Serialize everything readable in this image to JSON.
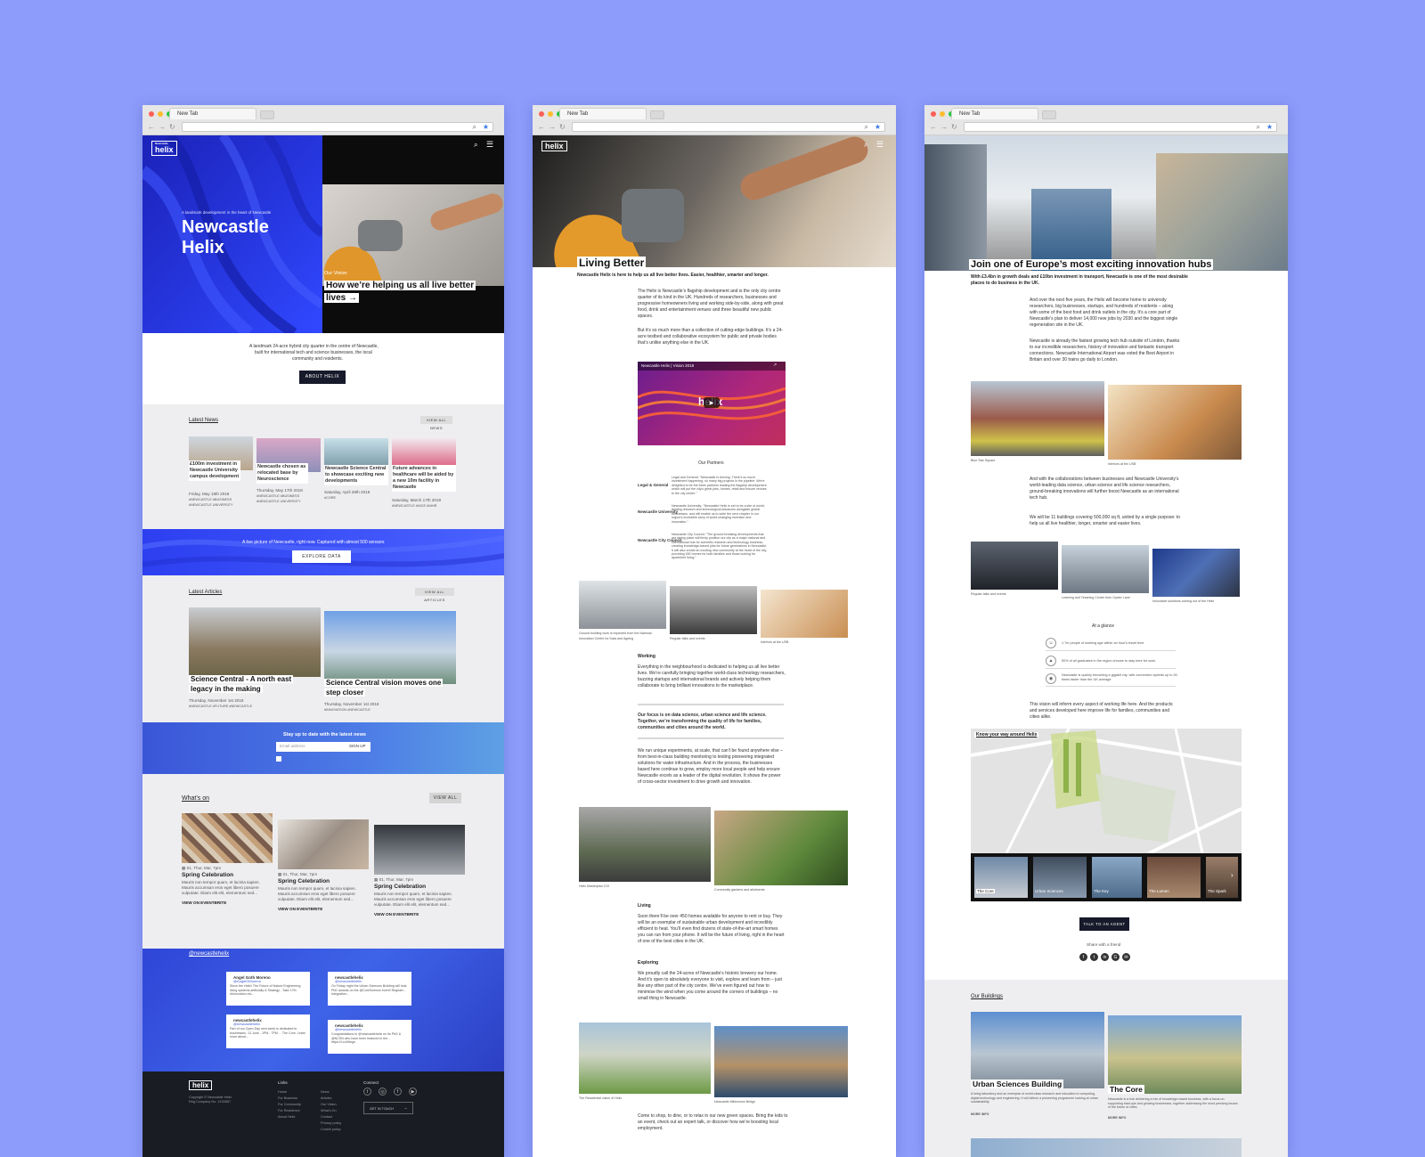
{
  "colors": {
    "bg": "#8d9cfb",
    "brand_blue": "#2a3be0",
    "dark": "#171a2a"
  },
  "browser": {
    "tab_title": "New Tab",
    "address": ""
  },
  "w1": {
    "logo": "helix",
    "logo_small": "Newcastle",
    "hero_kicker": "A landmark development in the heart of Newcastle",
    "hero_title_1": "Newcastle",
    "hero_title_2": "Helix",
    "vision_label": "Our Vision",
    "vision_title_1": "How we’re helping us all live better",
    "vision_title_2": "lives →",
    "intro_1": "A landmark 24-acre hybrid city quarter in the centre of Newcastle,",
    "intro_2": "built for international tech and science businesses, the local",
    "intro_3": "community and residents.",
    "about_btn": "ABOUT HELIX",
    "news_heading": "Latest News",
    "news_view_all": "VIEW ALL NEWS",
    "news": [
      {
        "title": "£100m investment in Newcastle University campus development",
        "date": "Friday, May 18th 2018",
        "tags": "#NEWCASTLE #BUSINESS #NEWCASTLE UNIVERSITY"
      },
      {
        "title": "Newcastle chosen as relocated base by Neuroscience",
        "date": "Thursday, May 17th 2018",
        "tags": "#NEWCASTLE #BUSINESS #NEWCASTLE UNIVERSITY"
      },
      {
        "title": "Newcastle Science Central to showcase exciting new developments",
        "date": "Saturday, April 28th 2018",
        "tags": "#CORE"
      },
      {
        "title": "Future advances in healthcare will be aided by a new 10m facility in Newcastle",
        "date": "Saturday, March 17th 2018",
        "tags": "#NEWCASTLE #NICE #NIHR"
      }
    ],
    "data_text": "A live picture of Newcastle, right now. Captured with almost 500 sensors",
    "data_btn": "EXPLORE DATA",
    "articles_heading": "Latest Articles",
    "articles_view_all": "VIEW ALL ARTICLES",
    "articles": [
      {
        "title_1": "Science Central - A north east",
        "title_2": "legacy in the making",
        "date": "Thursday, November 1st 2018",
        "tags": "#NEWCASTLE #FUTURE #NEWCASTLE"
      },
      {
        "title_1": "Science Central vision moves one",
        "title_2": "step closer",
        "date": "Thursday, November 1st 2018",
        "tags": "#INNOVATION #NEWCASTLE"
      }
    ],
    "newsletter_title": "Stay up to date with the latest news",
    "newsletter_placeholder": "Email address",
    "newsletter_btn": "SIGN UP",
    "whatson_heading": "What’s on",
    "whatson_view_all": "VIEW ALL",
    "events": [
      {
        "date": "01, Thur, Mar, 7pm",
        "title": "Spring Celebration",
        "desc": "Mauris non tempor quam, et lacinia sapien. Mauris accumsan eros eget libero posuere vulputate. Etiam elit elit, elementum sed...",
        "link": "VIEW ON EVENTBRITE"
      },
      {
        "date": "01, Thur, Mar, 7pm",
        "title": "Spring Celebration",
        "desc": "Mauris non tempor quam, et lacinia sapien. Mauris accumsan eros eget libero posuere vulputate. Etiam elit elit, elementum sed...",
        "link": "VIEW ON EVENTBRITE"
      },
      {
        "date": "01, Thur, Mar, 7pm",
        "title": "Spring Celebration",
        "desc": "Mauris non tempor quam, et lacinia sapien. Mauris accumsan eros eget libero posuere vulputate. Etiam elit elit, elementum sed...",
        "link": "VIEW ON EVENTBRITE"
      }
    ],
    "social_heading": "@newcastlehelix",
    "tweets": [
      {
        "user": "Angel Goth Moreno",
        "handle": "@AngelGMoreno",
        "text": "Since the Helix! The Future of Nature Engineering living systems artificially & Strategy - Take 17th #Innovation etc..."
      },
      {
        "user": "newcastlehelix",
        "handle": "@newcastlehelix",
        "text": "On Friday night the Urban Sciences Building will host PhD awards on the @CoreScience event! Register - Integration..."
      },
      {
        "user": "newcastlehelix",
        "handle": "@newcastlehelix",
        "text": "Part of our Open Day next week is dedicated to businesses. 13 June - 1PM - 7PM ... The Core. Learn more about..."
      },
      {
        "user": "newcastlehelix",
        "handle": "@newcastlehelix",
        "text": "Congratulations to @newcastlehelix on its PhD & @NCSN who have been featured in the... https://t.co/Mega"
      }
    ],
    "footer_logo": "helix",
    "footer_copy_1": "Copyright © Newcastle Helix",
    "footer_copy_2": "Reg Company No. 1234567",
    "footer_links_heading": "Links",
    "footer_links_1": [
      "Home",
      "For Business",
      "For Community",
      "For Residence",
      "About Helix"
    ],
    "footer_links_2": [
      "News",
      "Articles",
      "Our Vision",
      "What's On",
      "Contact",
      "Privacy policy",
      "Cookie policy"
    ],
    "footer_connect": "Connect",
    "footer_btn": "GET IN TOUCH"
  },
  "w2": {
    "logo": "helix",
    "title": "Living Better",
    "lead": "Newcastle Helix is here to help us all live better lives. Easier, healthier, smarter and longer.",
    "p1": "The Helix is Newcastle’s flagship development and is the only city centre quarter of its kind in the UK. Hundreds of researchers, businesses and progressive homeowners living and working side-by-side, along with great food, drink and entertainment venues and three beautiful new public spaces.",
    "p2": "But it’s so much more than a collection of cutting-edge buildings. It’s a 24-acre testbed and collaborative ecosystem for public and private bodies that’s unlike anything else in the UK.",
    "video_title": "Newcastle Helix | Vision 2018",
    "video_brand": "helix",
    "partners_heading": "Our Partners",
    "partners": [
      {
        "name": "Legal & General",
        "text": "Legal and General: \"Newcastle is thriving. There's so much investment happening, so many big projects in the pipeline. We're delighted to be the three partners leading the flagship development which will put the city's great jobs, homes, retail and leisure venues to the city centre.\""
      },
      {
        "name": "Newcastle University",
        "text": "Newcastle University: \"Newcastle Helix is set to be a site of world-leading research and technological advances alongside global businesses, and will enable us to write the next chapter in our region's incredible story of world-changing invention and innovation.\""
      },
      {
        "name": "Newcastle City Council",
        "text": "Newcastle City Council: \"The ground breaking developments that are taking place will firmly position our city as a major national and international hub for scientific research and technology business, creating knowledge-based jobs for future generations in Newcastle. It will also create an exciting new community at the heart of the city, providing 450 homes for both families and those looking for apartment living.\""
      }
    ],
    "gallery_1": [
      "Ground building work is expected from the National Innovation Centre for Data and Ageing",
      "Regular talks and events",
      "Interiors at the USB"
    ],
    "working_heading": "Working",
    "working_p": "Everything in the neighbourhood is dedicated to helping us all live better lives. We’re carefully bringing together world-class technology researchers, buzzing startups and international brands and actively helping them collaborate to bring brilliant innovations to the marketplace.",
    "focus_p": "Our focus is on data science, urban science and life science. Together, we’re transforming the quality of life for families, communities and cities around the world.",
    "experiments_p": "We run unique experiments, at scale, that can’t be found anywhere else – from best-in-class building monitoring to testing pioneering integrated solutions for water infrastructure. And in the process, the businesses based here continue to grow, employ more local people and help ensure Newcastle excels as a leader of the digital revolution. It shows the power of cross-sector investment to drive growth and innovation.",
    "gallery_2": [
      "Helix Masterplan CGI",
      "Community gardens and allotments"
    ],
    "living_heading": "Living",
    "living_p": "Soon there’ll be over 450 homes available for anyone to rent or buy. They will be an exemplar of sustainable urban development and incredibly efficient to heat. You’ll even find dozens of state-of-the-art smart homes you can run from your phone. It will be the future of living, right in the heart of one of the best cities in the UK.",
    "exploring_heading": "Exploring",
    "exploring_p": "We proudly call the 24-acres of Newcastle’s historic brewery our home. And it’s open to absolutely everyone to visit, explore and learn from – just like any other part of the city centre. We’ve even figured out how to minimise the wind when you come around the corners of buildings – no small thing in Newcastle.",
    "gallery_3": [
      "The Residential vision of Helix",
      "Newcastle Millennium Bridge"
    ],
    "closing_p": "Come to shop, to dine, or to relax in our new green spaces. Bring the kids to an event, check out an expert talk, or discover how we’re boosting local employment."
  },
  "w3": {
    "title": "Join one of Europe’s most exciting innovation hubs",
    "lead": "With £3.4bn in growth deals and £10bn investment in transport, Newcastle is one of the most desirable places to do business in the UK.",
    "p1": "And over the next five years, the Helix will become home to university researchers, big businesses, startups, and hundreds of residents – along with some of the best food and drink outlets in the city. It’s a core part of Newcastle’s plan to deliver 14,000 new jobs by 2030 and the biggest single regeneration site in the UK.",
    "p2": "Newcastle is already the fastest growing tech hub outside of London, thanks to our incredible researchers, history of innovation and fantastic transport connections. Newcastle International Airport was voted the Best Airport in Britain and over 30 trains go daily to London.",
    "gallery_1": [
      "Blue Star Square",
      "Interiors at the USB"
    ],
    "p3": "And with the collaborations between businesses and Newcastle University’s world-leading data science, urban science and life science researchers, ground-breaking innovations will further boost Newcastle as an international tech hub.",
    "p4": "We will be 11 buildings covering 500,000 sq ft, united by a single purpose: to help us all live healthier, longer, smarter and easier lives.",
    "gallery_2": [
      "Regular talks and events",
      "Learning and Teaching Centre from Oyster Lane",
      "Innovative solutions coming out of the Helix"
    ],
    "glance_heading": "At a glance",
    "glance": [
      {
        "icon": "people-icon",
        "text": "1.7m people of working age within an hour's travel time"
      },
      {
        "icon": "graduate-icon",
        "text": "50% of all graduates in the region choose to stay here for work"
      },
      {
        "icon": "location-icon",
        "text": "Newcastle is quickly becoming a gigabit city, with connection speeds up to 30 times faster than the UK average"
      }
    ],
    "p5": "This vision will inform every aspect of working life here. And the products and services developed here improve life for families, communities and cities alike.",
    "map_label": "Know your way around Helix",
    "carousel": [
      "The Core",
      "Urban Sciences",
      "The Key",
      "The Lumen",
      "The Spark"
    ],
    "agent_btn": "TALK TO AN AGENT",
    "share_label": "Share with a friend",
    "buildings_heading": "Our Buildings",
    "buildings": [
      {
        "title": "Urban Sciences Building",
        "desc": "A living laboratory and an exemplar of world-class research and education in computing, digital technology and engineering. It will deliver a pioneering programme looking at urban sustainability.",
        "link": "MORE INFO"
      },
      {
        "title": "The Core",
        "desc": "Newcastle is a hub delivering a mix of knowledge-based business, with a focus on supporting start-ups and growing businesses, together addressing the most pressing issues of the future of cities.",
        "link": "MORE INFO"
      }
    ]
  }
}
